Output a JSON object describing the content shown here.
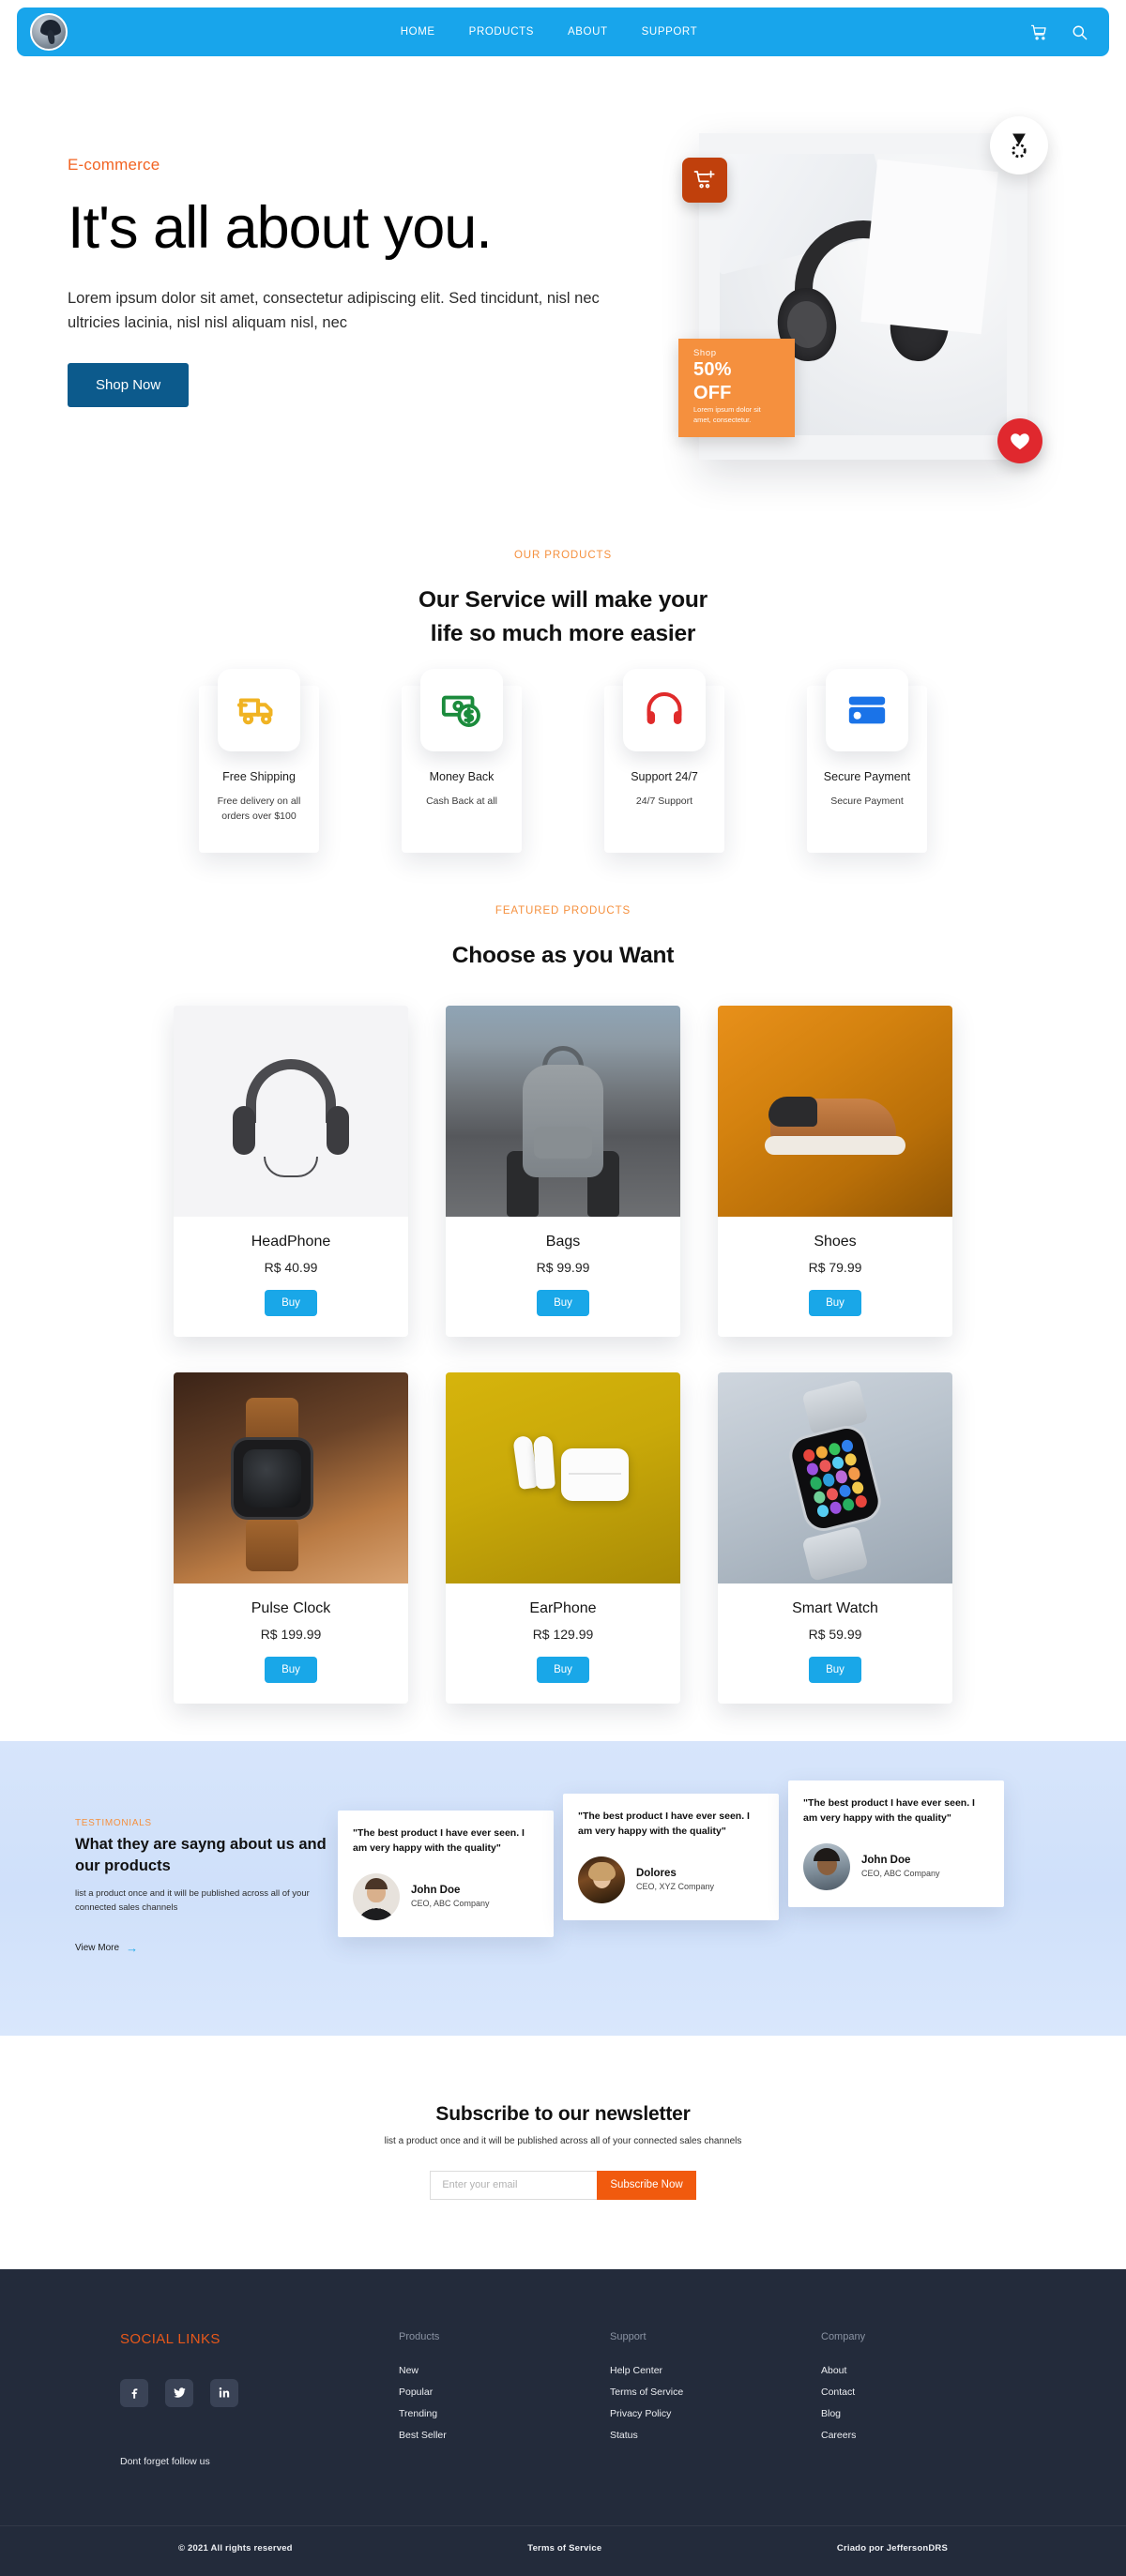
{
  "navbar": {
    "logo_icon": "brand-avatar-logo",
    "links": [
      {
        "label": "HOME"
      },
      {
        "label": "PRODUCTS"
      },
      {
        "label": "ABOUT"
      },
      {
        "label": "SUPPORT"
      }
    ],
    "cart_icon": "shopping-cart-icon",
    "search_icon": "search-icon"
  },
  "hero": {
    "eyebrow": "E-commerce",
    "title": "It's all about you.",
    "subtitle": "Lorem ipsum dolor sit amet, consectetur adipiscing elit. Sed tincidunt, nisl nec ultricies lacinia, nisl nisl aliquam nisl, nec",
    "cta": "Shop Now",
    "card": {
      "product_image": "black-over-ear-headphones",
      "badge_cart_icon": "add-to-cart-icon",
      "badge_medal_icon": "medal-award-icon",
      "badge_heart_icon": "heart-favorite-icon",
      "promo": {
        "kicker": "Shop",
        "headline": "50% OFF",
        "note": "Lorem ipsum dolor sit amet, consectetur."
      }
    },
    "accent_color": "#F26322",
    "cta_color": "#0C5A8C"
  },
  "services": {
    "eyebrow": "OUR PRODUCTS",
    "title_line1": "Our Service will make your",
    "title_line2": "life so much more easier",
    "items": [
      {
        "icon": "delivery-truck-icon",
        "title": "Free Shipping",
        "desc": "Free delivery on all orders over $100",
        "color": "#F0B323"
      },
      {
        "icon": "money-back-icon",
        "title": "Money Back",
        "desc": "Cash Back at all",
        "color": "#1B8B3C"
      },
      {
        "icon": "headset-support-icon",
        "title": "Support 24/7",
        "desc": "24/7 Support",
        "color": "#E02B2B"
      },
      {
        "icon": "credit-card-icon",
        "title": "Secure Payment",
        "desc": "Secure Payment",
        "color": "#1A73E8"
      }
    ]
  },
  "products": {
    "eyebrow": "FEATURED PRODUCTS",
    "title": "Choose as you Want",
    "buy_label": "Buy",
    "items": [
      {
        "image": "headphones-photo",
        "name": "HeadPhone",
        "price": "R$ 40.99"
      },
      {
        "image": "grey-backpack-photo",
        "name": "Bags",
        "price": "R$ 99.99"
      },
      {
        "image": "brown-sneaker-photo",
        "name": "Shoes",
        "price": "R$ 79.99"
      },
      {
        "image": "pulse-clock-photo",
        "name": "Pulse Clock",
        "price": "R$ 199.99"
      },
      {
        "image": "earphones-photo",
        "name": "EarPhone",
        "price": "R$ 129.99"
      },
      {
        "image": "smart-watch-photo",
        "name": "Smart Watch",
        "price": "R$ 59.99"
      }
    ]
  },
  "testimonials": {
    "eyebrow": "TESTIMONIALS",
    "title": "What they are sayng about us and our products",
    "desc": "list a product once and it will be published across all of your connected sales channels",
    "view_more": "View More",
    "arrow_icon": "arrow-right-icon",
    "cards": [
      {
        "quote": "\"The best product I have ever seen. I am very happy with the quality\"",
        "name": "John Doe",
        "role": "CEO, ABC Company",
        "avatar": "avatar-man-glasses"
      },
      {
        "quote": "\"The best product I have ever seen. I am very happy with the quality\"",
        "name": "Dolores",
        "role": "CEO, XYZ Company",
        "avatar": "avatar-woman-blonde"
      },
      {
        "quote": "\"The best product I have ever seen. I am very happy with the quality\"",
        "name": "John Doe",
        "role": "CEO, ABC Company",
        "avatar": "avatar-man-beard"
      }
    ]
  },
  "newsletter": {
    "title": "Subscribe to our newsletter",
    "desc": "list a product once and it will be published across all of your connected sales channels",
    "placeholder": "Enter your email",
    "value": "",
    "button": "Subscribe Now",
    "button_color": "#F15A0E"
  },
  "footer": {
    "social_title": "SOCIAL LINKS",
    "social": [
      {
        "icon": "facebook-icon"
      },
      {
        "icon": "twitter-icon"
      },
      {
        "icon": "linkedin-icon"
      }
    ],
    "follow_text": "Dont forget follow us",
    "columns": [
      {
        "title": "Products",
        "links": [
          "New",
          "Popular",
          "Trending",
          "Best Seller"
        ]
      },
      {
        "title": "Support",
        "links": [
          "Help Center",
          "Terms of Service",
          "Privacy Policy",
          "Status"
        ]
      },
      {
        "title": "Company",
        "links": [
          "About",
          "Contact",
          "Blog",
          "Careers"
        ]
      }
    ],
    "bottom": [
      "© 2021 All rights reserved",
      "Terms of Service",
      "Criado por JeffersonDRS"
    ],
    "bg_color": "#232B3B",
    "accent_color": "#E8581A"
  }
}
